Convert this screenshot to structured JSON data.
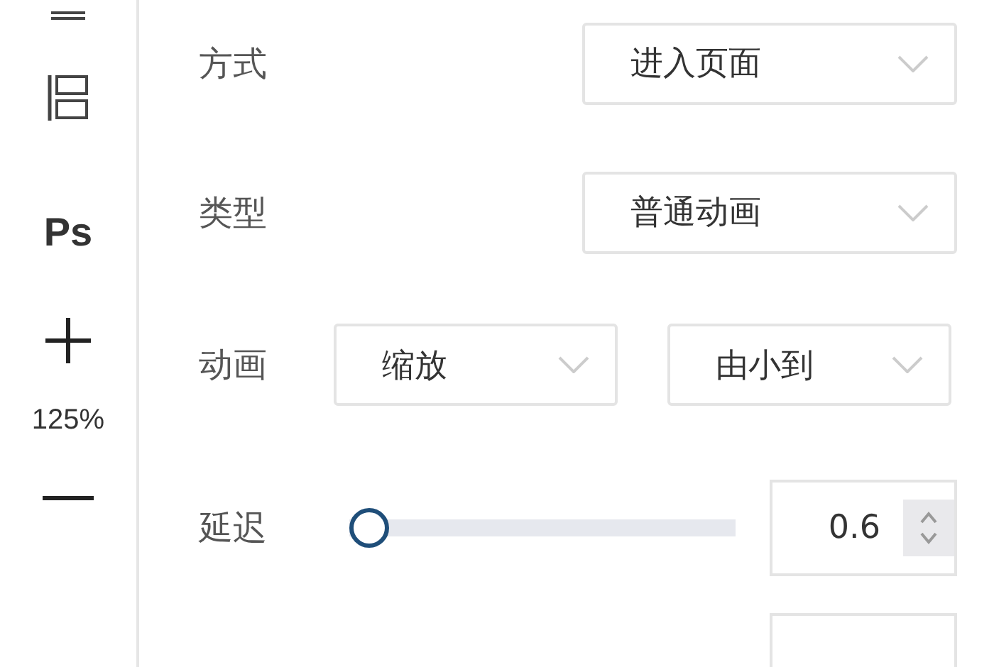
{
  "sidebar": {
    "items": [
      {
        "kind": "align"
      },
      {
        "kind": "layout"
      },
      {
        "kind": "text",
        "label": "Ps"
      },
      {
        "kind": "plus"
      },
      {
        "kind": "text",
        "label": "125%"
      },
      {
        "kind": "minus"
      }
    ]
  },
  "form": {
    "rows": [
      {
        "kind": "select",
        "label": "方式",
        "values": [
          "进入页面"
        ]
      },
      {
        "kind": "select",
        "label": "类型",
        "values": [
          "普通动画"
        ]
      },
      {
        "kind": "select2",
        "label": "动画",
        "values": [
          "缩放",
          "由小到"
        ]
      },
      {
        "kind": "slider",
        "label": "延迟",
        "level": 0,
        "value": "0.6"
      }
    ]
  }
}
